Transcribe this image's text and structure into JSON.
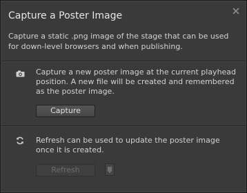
{
  "dialog": {
    "title": "Capture a Poster Image",
    "intro": "Capture a static .png image of the stage that can be used for down-level browsers and when publishing."
  },
  "capture_section": {
    "icon": "camera-icon",
    "description": "Capture a new poster image at the current playhead position.  A new file will be created and remembered as the poster image.",
    "button_label": "Capture"
  },
  "refresh_section": {
    "icon": "refresh-icon",
    "description": "Refresh can be used to update the poster image once it is created.",
    "button_label": "Refresh",
    "button_enabled": false
  },
  "colors": {
    "background": "#3a3a3a",
    "text": "#d2d2d2",
    "disabled_text": "#6c6c6c"
  }
}
